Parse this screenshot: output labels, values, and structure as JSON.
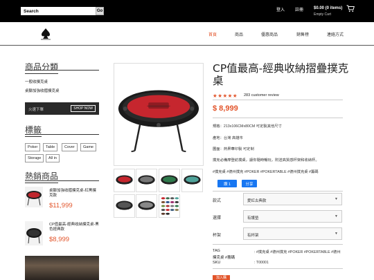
{
  "header": {
    "search_value": "Search",
    "search_button": "Go",
    "login": "登入",
    "register": "註冊",
    "cart_amount": "$0.00 (0 items)",
    "cart_status": "Empty Cart"
  },
  "nav": {
    "items": [
      {
        "label": "首頁",
        "active": true
      },
      {
        "label": "商品"
      },
      {
        "label": "優惠商品"
      },
      {
        "label": "銷售榜"
      },
      {
        "label": "連絡方式"
      }
    ]
  },
  "sidebar": {
    "categories_title": "商品分類",
    "categories": [
      "一般收撲克桌",
      "桌腳加強收摺撲克桌"
    ],
    "promo_text": "火速下單",
    "promo_button": "SHOP NOW",
    "tags_title": "標籤",
    "tags": [
      "Poker",
      "Table",
      "Cover",
      "Game",
      "Storage",
      "All in"
    ],
    "hot_title": "熱銷商品",
    "hot_items": [
      {
        "name": "桌腳加強收摺撲克桌-紅黑撲克款",
        "price": "$11,999"
      },
      {
        "name": "CP值最高-經典收納撲克桌-黑色經典款",
        "price": "$8,999"
      }
    ]
  },
  "product": {
    "title": "CP值最高-經典收納摺疊撲克桌",
    "stars": "★★★★★",
    "rating_value": 5,
    "review_count": "283 customer review",
    "price": "$ 8,999",
    "specs": [
      "規格：213x106CMx80CM 可定製其他尺寸",
      "產地：台灣 高雄市",
      "圖面：熱昇華印製 可定制",
      "撲克必備摩登紡撲桌，讓你隨時暢玩，附送高質感杯架和收納杯。"
    ],
    "hashtags": "#撲克桌 #德州撲克 #POKER #POKERTABLE #德州撲克桌 #籌碼",
    "like_label": "讚 1",
    "share_label": "分享",
    "options": [
      {
        "label": "款式",
        "value": "愛紅古典款"
      },
      {
        "label": "選擇",
        "value": "有護墊"
      },
      {
        "label": "杯架",
        "value": "有杯架"
      }
    ],
    "tag_label": "TAG",
    "tag_value": ": #撲克桌 #德州撲克 #POKER #POKERTABLE #德州",
    "tag_value_2": "撲克桌 #籌碼",
    "sku_label": "SKU",
    "sku_value": ": T00001",
    "buy_label": "加入購"
  },
  "colors": {
    "accent": "#e2542a",
    "topbar": "#000000",
    "facebook": "#1877f2"
  }
}
